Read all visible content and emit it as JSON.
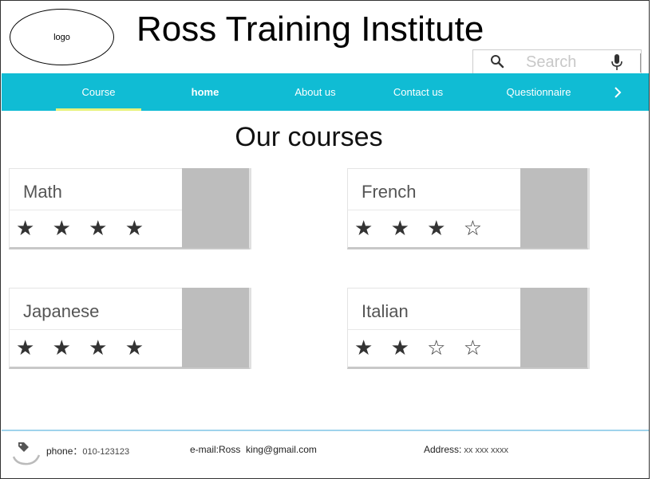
{
  "header": {
    "logo_text": "logo",
    "title": "Ross Training Institute"
  },
  "search": {
    "placeholder": "Search"
  },
  "nav": {
    "tabs": [
      {
        "label": "Course",
        "active": true
      },
      {
        "label": "home"
      },
      {
        "label": "About us"
      },
      {
        "label": "Contact us"
      },
      {
        "label": "Questionnaire"
      }
    ],
    "accent_color": "#10bcd4",
    "active_underline_color": "#e7f27a"
  },
  "main": {
    "section_title": "Our courses",
    "courses": [
      {
        "name": "Math",
        "stars": "★ ★ ★ ★",
        "rating": 4
      },
      {
        "name": "French",
        "stars": "★ ★ ★ ☆",
        "rating": 3
      },
      {
        "name": "Japanese",
        "stars": "★ ★ ★ ★",
        "rating": 4
      },
      {
        "name": "Italian",
        "stars": "★ ★ ☆ ☆",
        "rating": 2
      }
    ]
  },
  "footer": {
    "phone_label": "phone：",
    "phone_value": "010-123123",
    "email_label": "e-mail:",
    "email_value": "Ross  king@gmail.com",
    "address_label": "Address:",
    "address_value": " xx xxx xxxx"
  },
  "icons": [
    "search-icon",
    "microphone-icon",
    "chevron-right-icon",
    "tag-icon"
  ]
}
